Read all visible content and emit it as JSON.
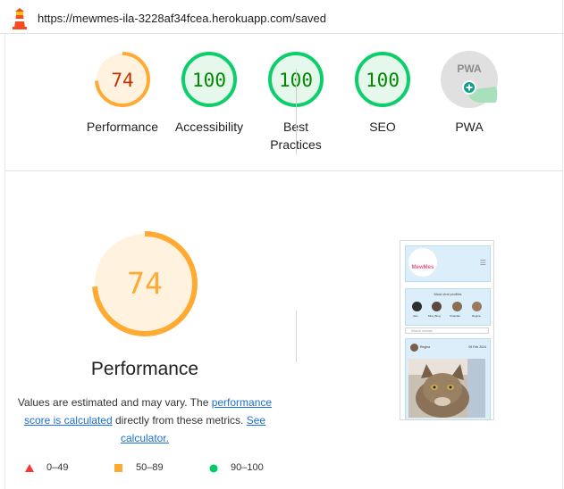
{
  "browser": {
    "url": "https://mewmes-ila-3228af34fcea.herokuapp.com/saved"
  },
  "scores": [
    {
      "label": "Performance",
      "score": "74",
      "level": "average"
    },
    {
      "label": "Accessibility",
      "score": "100",
      "level": "pass"
    },
    {
      "label": "Best Practices",
      "score": "100",
      "level": "pass"
    },
    {
      "label": "SEO",
      "score": "100",
      "level": "pass"
    },
    {
      "label": "PWA",
      "score": "",
      "level": "pwa"
    }
  ],
  "pwa_badge": "PWA",
  "perf": {
    "score": "74",
    "score_fraction": 0.74,
    "title": "Performance",
    "note_prefix": "Values are estimated and may vary. The ",
    "note_link1": "performance score is calculated",
    "note_middle": " directly from these metrics. ",
    "note_link2": "See calculator."
  },
  "legend": [
    {
      "range": "0–49",
      "shape": "triangle",
      "color": "#f33"
    },
    {
      "range": "50–89",
      "shape": "square",
      "color": "#fa3"
    },
    {
      "range": "90–100",
      "shape": "circle",
      "color": "#0c6"
    }
  ],
  "colors": {
    "average": "#fa3",
    "average_text": "#c33300",
    "average_bg": "#fff3e0",
    "pass": "#0cce6b",
    "pass_text": "#008800",
    "pass_bg": "#e6f8ec"
  },
  "thumbnail": {
    "logo_text": "MewMes",
    "panel_title": "Most viral profiles",
    "profiles": [
      "Alex",
      "Mira_Blog",
      "Chandler",
      "Regina"
    ],
    "search_placeholder": "Search memes",
    "post_user": "Regina",
    "post_date": "09 Feb 2024"
  }
}
